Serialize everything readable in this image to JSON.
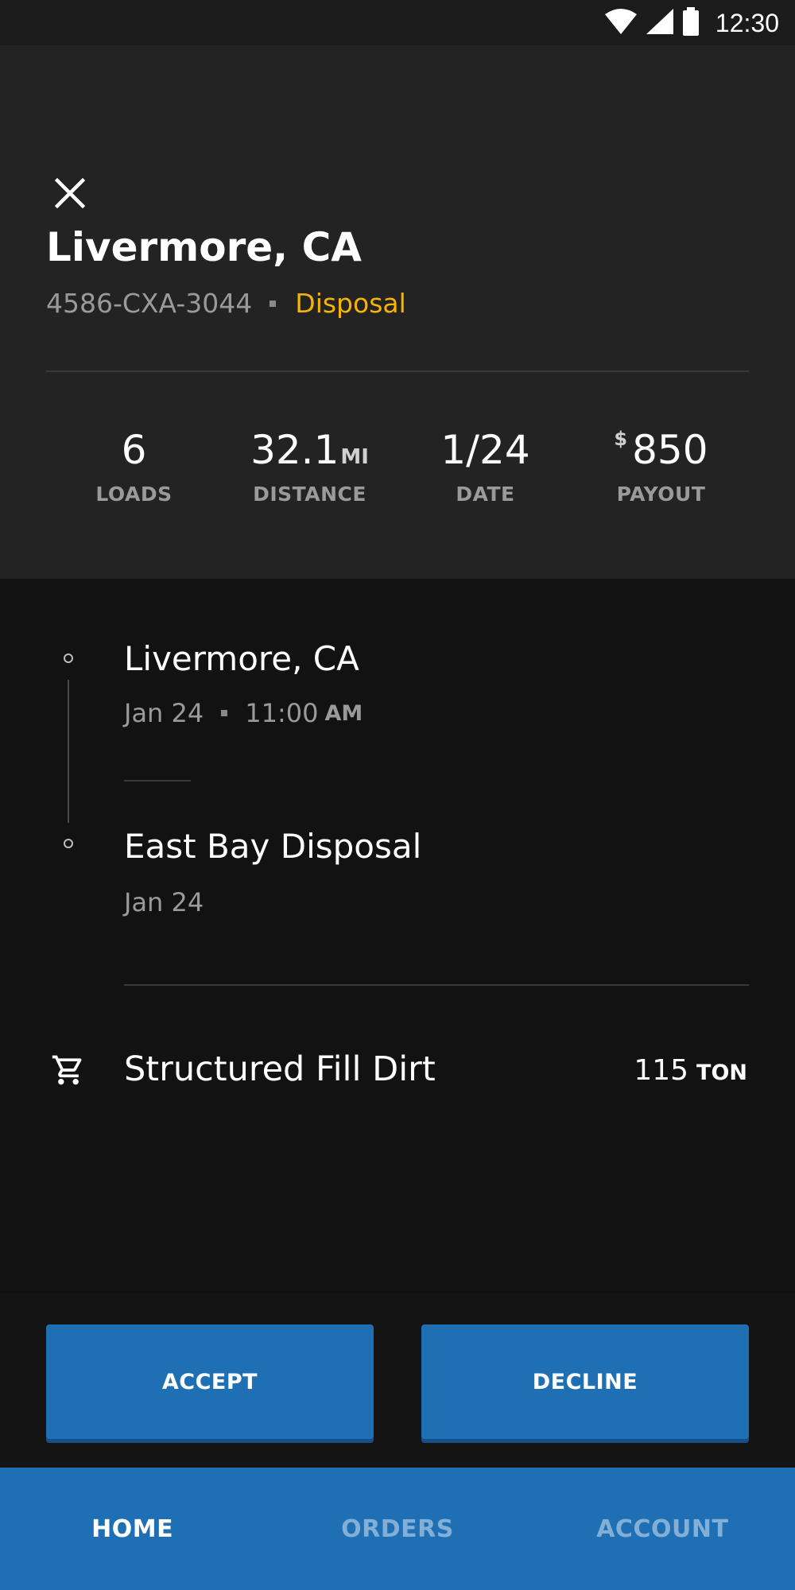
{
  "status_bar": {
    "time": "12:30",
    "icons": [
      "wifi-icon",
      "signal-icon",
      "battery-icon"
    ]
  },
  "header": {
    "close_icon": "close-icon",
    "title": "Livermore, CA",
    "job_id": "4586-CXA-3044",
    "job_type": "Disposal",
    "stats": {
      "loads": {
        "value": "6",
        "label": "LOADS"
      },
      "distance": {
        "value": "32.1",
        "unit": "MI",
        "label": "DISTANCE"
      },
      "date": {
        "value": "1/24",
        "label": "DATE"
      },
      "payout": {
        "prefix": "$",
        "value": "850",
        "label": "PAYOUT"
      }
    }
  },
  "route": {
    "origin": {
      "name": "Livermore, CA",
      "date": "Jan 24",
      "time": "11:00",
      "ampm": "AM"
    },
    "destination": {
      "name": "East Bay Disposal",
      "date": "Jan 24"
    }
  },
  "material": {
    "icon": "cart-icon",
    "name": "Structured Fill Dirt",
    "quantity": "115",
    "unit": "TON"
  },
  "actions": {
    "accept_label": "ACCEPT",
    "decline_label": "DECLINE"
  },
  "nav": {
    "home": "HOME",
    "orders": "ORDERS",
    "account": "ACCOUNT"
  },
  "colors": {
    "accent_blue": "#1f6fb5",
    "job_type_yellow": "#f5b400",
    "header_bg": "#232323",
    "body_bg": "#121212"
  }
}
